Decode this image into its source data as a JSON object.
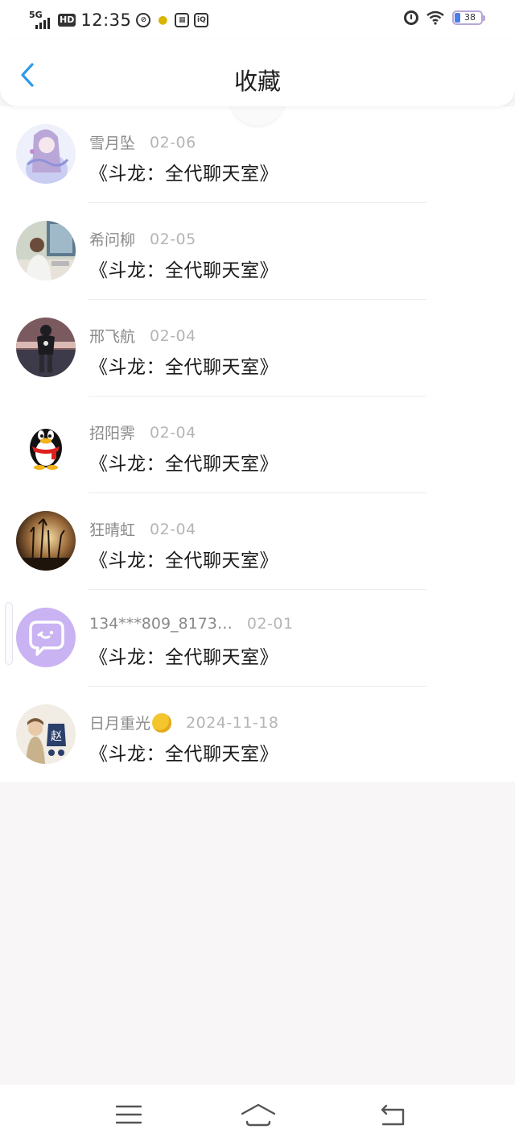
{
  "status_bar": {
    "network": "5G",
    "hd": "HD",
    "time": "12:35",
    "battery": "38",
    "icons": [
      "signal-icon",
      "hd-icon",
      "app-icon-1",
      "chick-app-icon",
      "video-app-icon",
      "iqiyi-app-icon",
      "alarm-icon",
      "wifi-icon",
      "battery-icon"
    ]
  },
  "header": {
    "title": "收藏",
    "back_icon": "chevron-left-icon"
  },
  "items": [
    {
      "name": "雪月坠",
      "date": "02-06",
      "title": "《斗龙：全代聊天室》"
    },
    {
      "name": "希问柳",
      "date": "02-05",
      "title": "《斗龙：全代聊天室》"
    },
    {
      "name": "邢飞航",
      "date": "02-04",
      "title": "《斗龙：全代聊天室》"
    },
    {
      "name": "招阳霁",
      "date": "02-04",
      "title": "《斗龙：全代聊天室》"
    },
    {
      "name": "狂晴虹",
      "date": "02-04",
      "title": "《斗龙：全代聊天室》"
    },
    {
      "name": "134***809_8173…",
      "date": "02-01",
      "title": "《斗龙：全代聊天室》"
    },
    {
      "name": "日月重光",
      "date": "2024-11-18",
      "title": "《斗龙：全代聊天室》"
    }
  ],
  "avatar_text": {
    "zhao": "赵"
  },
  "nav": {
    "menu_icon": "menu-icon",
    "home_icon": "home-icon",
    "back_icon": "back-icon"
  },
  "colors": {
    "accent": "#2f9ae9",
    "background": "#f8f6f7",
    "name_gray": "#8a8a8a",
    "date_gray": "#b5b5b5"
  }
}
